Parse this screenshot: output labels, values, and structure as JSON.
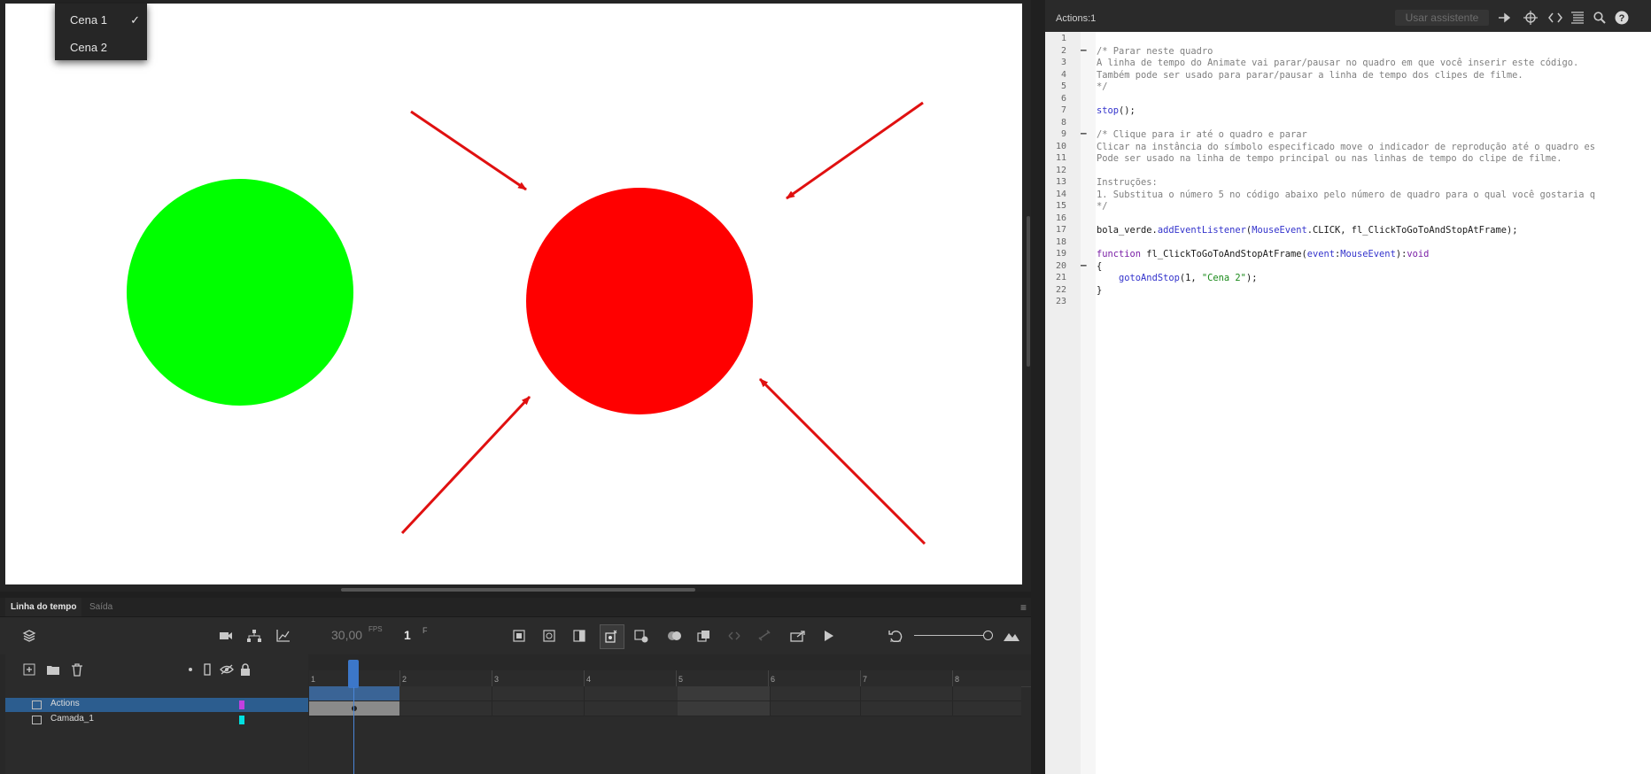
{
  "scene_menu": {
    "items": [
      {
        "label": "Cena 1",
        "checked": true
      },
      {
        "label": "Cena 2",
        "checked": false
      }
    ]
  },
  "stage": {
    "background": "#ffffff",
    "green_circle_color": "#00ff00",
    "red_circle_color": "#ff0000",
    "arrow_color": "#e01010"
  },
  "timeline": {
    "tabs": [
      "Linha do tempo",
      "Saída"
    ],
    "fps_value": "30,00",
    "fps_unit": "FPS",
    "current_frame": "1",
    "frame_unit": "F",
    "ruler_labels": [
      "1",
      "2",
      "3",
      "4",
      "5",
      "6",
      "7",
      "8"
    ],
    "layers": [
      {
        "name": "Actions",
        "color": "#c040e0",
        "selected": true
      },
      {
        "name": "Camada_1",
        "color": "#00e0e0",
        "selected": false
      }
    ]
  },
  "actions_panel": {
    "title": "Actions:1",
    "assist_button": "Usar assistente",
    "line_numbers": [
      "1",
      "2",
      "3",
      "4",
      "5",
      "6",
      "7",
      "8",
      "9",
      "10",
      "11",
      "12",
      "13",
      "14",
      "15",
      "16",
      "17",
      "18",
      "19",
      "20",
      "21",
      "22",
      "23"
    ],
    "code_lines": [
      "",
      "/* Parar neste quadro",
      "A linha de tempo do Animate vai parar/pausar no quadro em que você inserir este código.",
      "Também pode ser usado para parar/pausar a linha de tempo dos clipes de filme.",
      "*/",
      "",
      "stop();",
      "",
      "/* Clique para ir até o quadro e parar",
      "Clicar na instância do símbolo especificado move o indicador de reprodução até o quadro es",
      "Pode ser usado na linha de tempo principal ou nas linhas de tempo do clipe de filme.",
      "",
      "Instruções:",
      "1. Substitua o número 5 no código abaixo pelo número de quadro para o qual você gostaria q",
      "*/",
      "",
      "bola_verde.addEventListener(MouseEvent.CLICK, fl_ClickToGoToAndStopAtFrame);",
      "",
      "function fl_ClickToGoToAndStopAtFrame(event:MouseEvent):void",
      "{",
      "    gotoAndStop(1, \"Cena 2\");",
      "}",
      ""
    ]
  }
}
